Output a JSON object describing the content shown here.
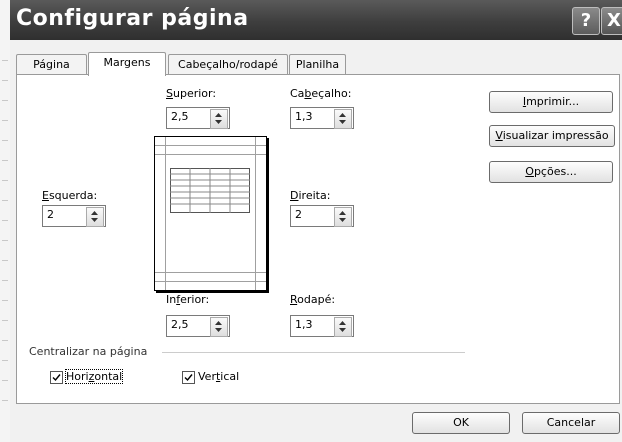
{
  "dialog": {
    "title": "Configurar página",
    "help_glyph": "?",
    "close_glyph": "X"
  },
  "tabs": [
    {
      "label": "Página"
    },
    {
      "label": "Margens",
      "active": true
    },
    {
      "label": "Cabeçalho/rodapé"
    },
    {
      "label": "Planilha"
    }
  ],
  "margins": {
    "superior": {
      "label_key": "S",
      "label_rest": "uperior:",
      "value": "2,5"
    },
    "cabecalho": {
      "label_pre": "Ca",
      "label_key": "b",
      "label_rest": "eçalho:",
      "value": "1,3"
    },
    "esquerda": {
      "label_key": "E",
      "label_rest": "squerda:",
      "value": "2"
    },
    "direita": {
      "label_key": "D",
      "label_rest": "ireita:",
      "value": "2"
    },
    "inferior": {
      "label_pre": "In",
      "label_key": "f",
      "label_rest": "erior:",
      "value": "2,5"
    },
    "rodape": {
      "label_key": "R",
      "label_rest": "odapé:",
      "value": "1,3"
    }
  },
  "buttons": {
    "imprimir": {
      "key": "I",
      "rest": "mprimir..."
    },
    "visualizar": {
      "key": "V",
      "rest": "isualizar impressão"
    },
    "opcoes": {
      "key": "O",
      "rest": "pções..."
    },
    "ok": "OK",
    "cancelar": "Cancelar"
  },
  "center": {
    "group_label": "Centralizar na página",
    "horizontal": {
      "pre": "Hori",
      "key": "z",
      "rest": "ontal",
      "checked": true
    },
    "vertical": {
      "pre": "Ver",
      "key": "t",
      "rest": "ical",
      "checked": true
    }
  }
}
